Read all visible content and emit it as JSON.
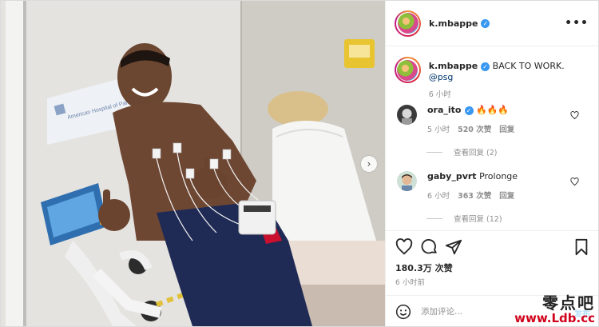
{
  "post": {
    "author": "k.mbappe",
    "caption_text": "BACK TO WORK.",
    "caption_mention": "@psg",
    "caption_time": "6 小时",
    "likes": "180.3万 次赞",
    "posted_time": "6 小时前"
  },
  "photo": {
    "sign_text": "American Hospital of Paris",
    "next_icon": "chevron-right-icon"
  },
  "comments": [
    {
      "user": "ora_ito",
      "text": "🔥🔥🔥",
      "verified": true,
      "time": "5 小时",
      "likes": "520 次赞",
      "reply_label": "回复",
      "replies": "查看回复 (2)"
    },
    {
      "user": "gaby_pvrt",
      "text": "Prolonge",
      "verified": false,
      "time": "6 小时",
      "likes": "363 次赞",
      "reply_label": "回复",
      "replies": "查看回复 (12)"
    }
  ],
  "composer": {
    "placeholder": "添加评论...",
    "publish_label": "发布",
    "emoji_icon": "smiley-icon"
  },
  "icons": {
    "like": "heart-icon",
    "comment": "comment-bubble-icon",
    "share": "paper-plane-icon",
    "save": "bookmark-icon",
    "more": "more-dots-icon",
    "verified": "verified-badge-icon"
  },
  "colors": {
    "verified_blue": "#3897f0",
    "mention_blue": "#00376b",
    "muted_gray": "#8e8e8e",
    "publish_disabled": "#b2dffc",
    "watermark_red": "#d0021b"
  },
  "watermark": {
    "line1": "零点吧",
    "line2": "www.Ldb.cc"
  }
}
